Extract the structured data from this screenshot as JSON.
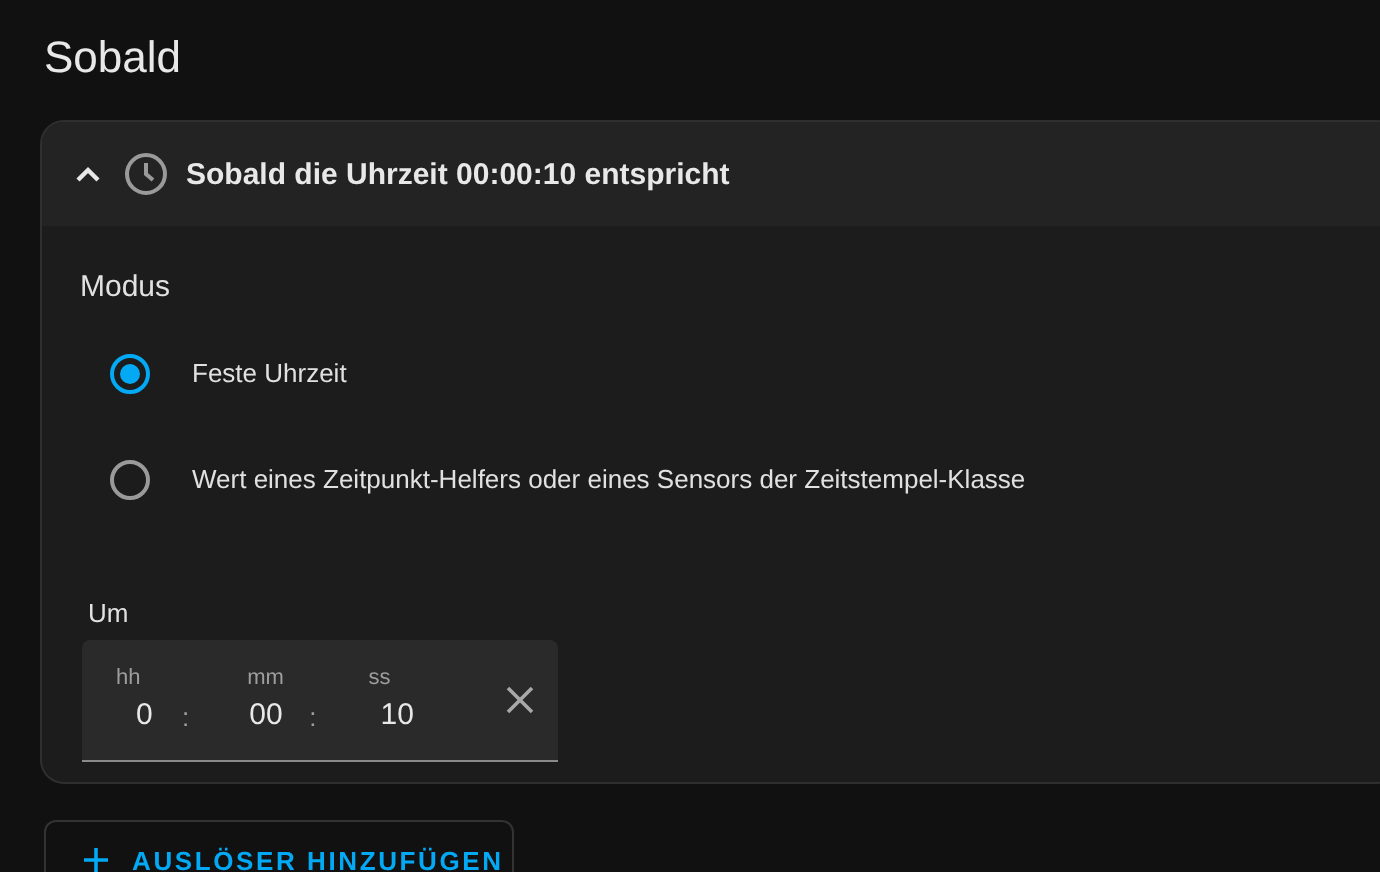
{
  "page_title": "Sobald",
  "trigger": {
    "expanded": true,
    "title": "Sobald die Uhrzeit 00:00:10 entspricht"
  },
  "mode": {
    "label": "Modus",
    "options": [
      {
        "label": "Feste Uhrzeit",
        "selected": true
      },
      {
        "label": "Wert eines Zeitpunkt-Helfers oder eines Sensors der Zeitstempel-Klasse",
        "selected": false
      }
    ]
  },
  "time": {
    "label": "Um",
    "parts": [
      {
        "label": "hh",
        "value": "0"
      },
      {
        "label": "mm",
        "value": "00"
      },
      {
        "label": "ss",
        "value": "10"
      }
    ],
    "separators": [
      ":",
      ":"
    ]
  },
  "add_button": {
    "label": "AUSLÖSER HINZUFÜGEN"
  }
}
